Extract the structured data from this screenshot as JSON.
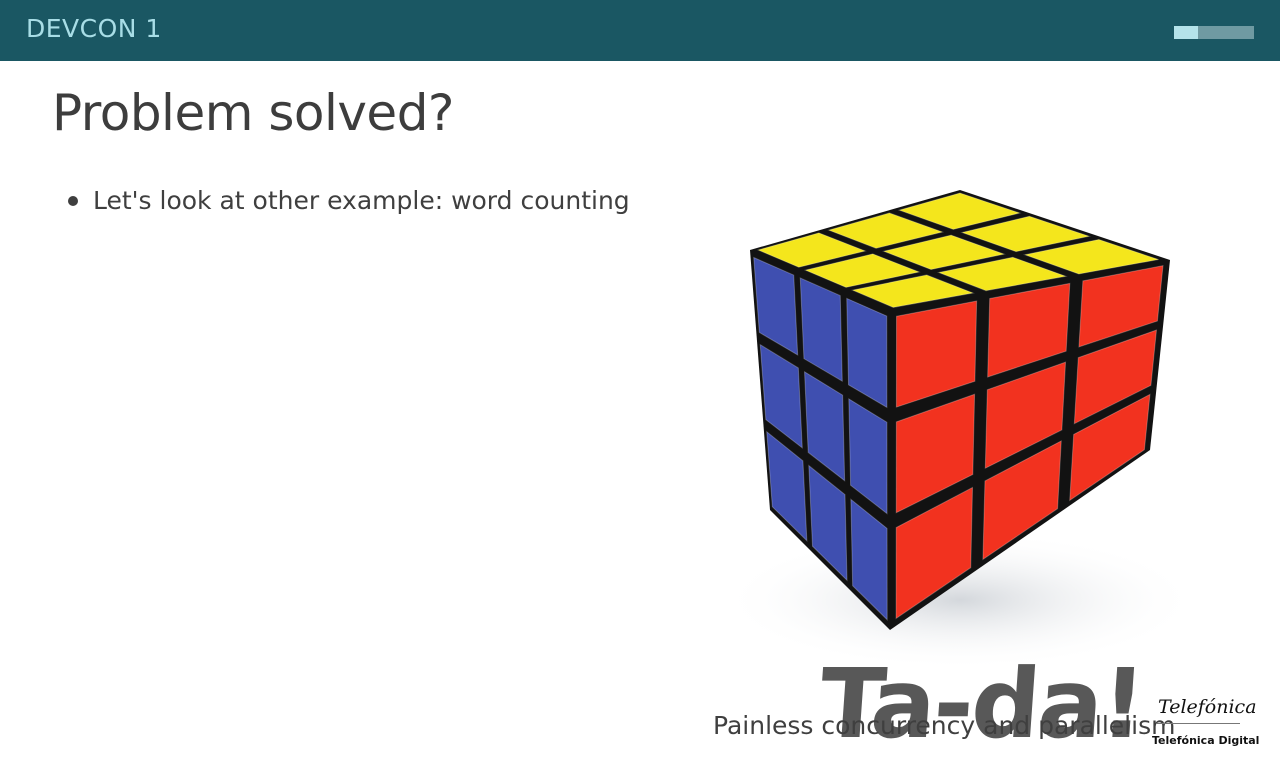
{
  "header": {
    "title": "DEVCON 1",
    "progress_fraction": 0.3
  },
  "slide": {
    "title": "Problem solved?",
    "bullets": [
      "Let's look at other example: word counting"
    ],
    "image_caption_handwritten": "Ta-da!",
    "footer_text": "Painless concurrency and parallelism"
  },
  "logo": {
    "script_text": "Telefónica",
    "caption": "Telefónica Digital"
  },
  "colors": {
    "header_bg": "#1a5763",
    "header_text": "#a8dde6",
    "cube_yellow": "#f4e61c",
    "cube_blue": "#3f4fb0",
    "cube_red": "#f2321f"
  },
  "icons": {
    "image": "rubiks-cube-icon",
    "bullet": "bullet-dot-icon"
  }
}
